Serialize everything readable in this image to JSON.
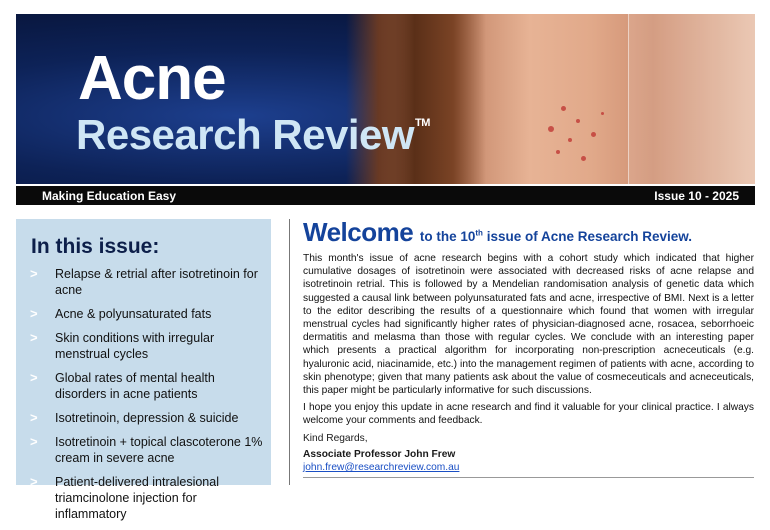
{
  "header": {
    "title_line1": "Acne",
    "title_line2": "Research Review",
    "trademark": "TM",
    "tagline": "Making Education Easy",
    "issue": "Issue 10 - 2025"
  },
  "sidebar": {
    "heading": "In this issue:",
    "items": [
      "Relapse & retrial after isotretinoin for acne",
      "Acne & polyunsaturated fats",
      "Skin conditions with irregular menstrual cycles",
      "Global rates of mental health disorders in acne patients",
      "Isotretinoin, depression & suicide",
      "Isotretinoin + topical clascoterone 1% cream in severe acne",
      "Patient-delivered intralesional triamcinolone injection for inflammatory"
    ]
  },
  "welcome": {
    "big": "Welcome",
    "rest_pre": "to the 10",
    "sup": "th",
    "rest_post": "issue of Acne Research Review.",
    "paragraph1": "This month's issue of acne research begins with a cohort study which indicated that higher cumulative dosages of isotretinoin were associated with decreased risks of acne relapse and isotretinoin retrial. This is followed by a Mendelian randomisation analysis of genetic data which suggested a causal link between polyunsaturated fats and acne, irrespective of BMI. Next is a letter to the editor describing the results of a questionnaire which found that women with irregular menstrual cycles had significantly higher rates of physician-diagnosed acne, rosacea, seborrhoeic dermatitis and melasma than those with regular cycles. We conclude with an interesting paper which presents a practical algorithm for incorporating non-prescription acneceuticals (e.g. hyaluronic acid, niacinamide, etc.) into the management regimen of patients with acne, according to skin phenotype; given that many patients ask about the value of cosmeceuticals and acneceuticals, this paper might be particularly informative for such discussions.",
    "paragraph2": "I hope you enjoy this update in acne research and find it valuable for your clinical practice. I always welcome your comments and feedback.",
    "signoff": "Kind Regards,",
    "signer": "Associate Professor John Frew",
    "email": "john.frew@researchreview.com.au"
  },
  "colors": {
    "welcome_blue": "#14439b",
    "sidebar_bg": "#c7dceb",
    "link_blue": "#1a4fc4"
  }
}
